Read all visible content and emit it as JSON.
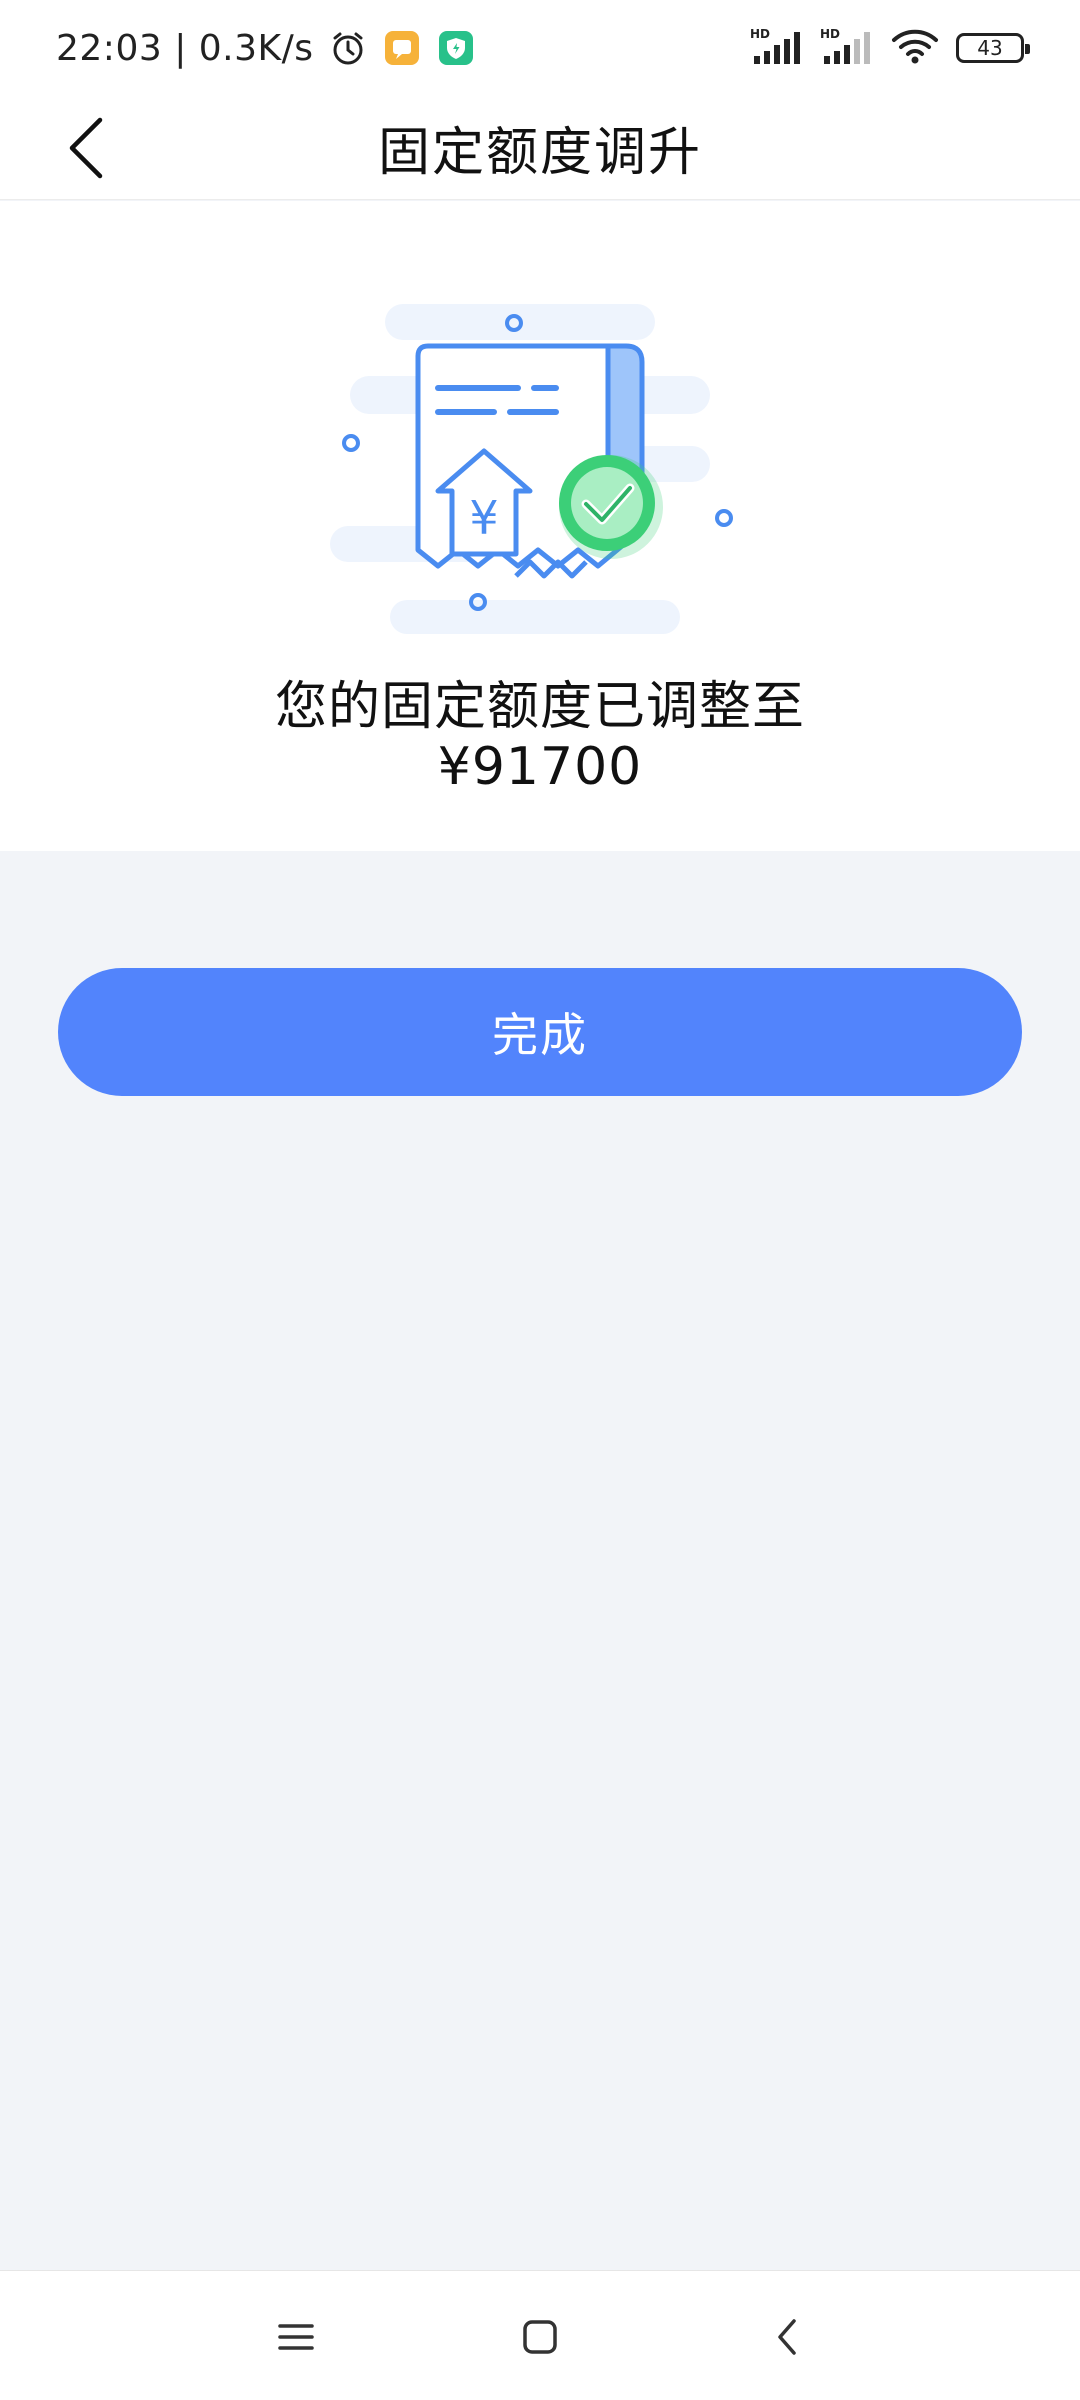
{
  "status_bar": {
    "time": "22:03 | 0.3K/s",
    "battery": "43",
    "icons": [
      "alarm-icon",
      "notes-app-icon",
      "security-app-icon",
      "hd-signal-icon",
      "hd-signal-icon",
      "wifi-icon",
      "battery-icon"
    ]
  },
  "header": {
    "title": "固定额度调升",
    "back_icon": "back-arrow-icon"
  },
  "result": {
    "message": "您的固定额度已调整至",
    "amount": "¥91700",
    "illustration": "receipt-with-upgrade-and-check-icon"
  },
  "actions": {
    "done_label": "完成"
  },
  "nav_bar": {
    "icons": [
      "menu-icon",
      "home-icon",
      "back-icon"
    ]
  },
  "colors": {
    "accent": "#5284fc",
    "success": "#3ccf78",
    "background": "#f2f4f8"
  }
}
